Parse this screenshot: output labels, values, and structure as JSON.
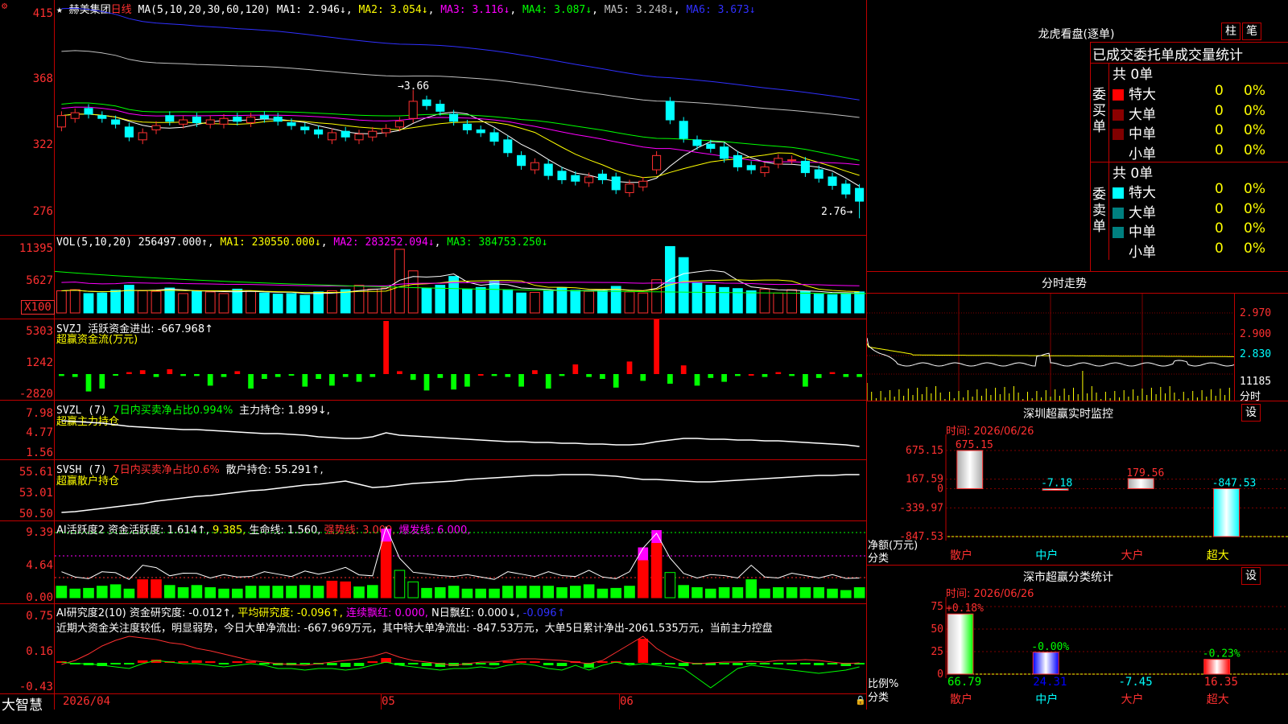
{
  "main_chart": {
    "header": {
      "star": "★",
      "name": "赫美集团",
      "period": "日线",
      "ma_def": "MA(5,10,20,30,60,120)",
      "ma1": "MA1: 2.946↓",
      "ma2": "MA2: 3.054↓",
      "ma3": "MA3: 3.116↓",
      "ma4": "MA4: 3.087↓",
      "ma5": "MA5: 3.248↓",
      "ma6": "MA6: 3.673↓"
    },
    "y_ticks": [
      "415",
      "368",
      "322",
      "276"
    ],
    "high_label": "3.66",
    "low_label": "2.76"
  },
  "vol_panel": {
    "header": {
      "def": "VOL(5,10,20)",
      "v": "256497.000↑",
      "ma1": "MA1: 230550.000↓",
      "ma2": "MA2: 283252.094↓",
      "ma3": "MA3: 384753.250↓"
    },
    "y_ticks": [
      "11395",
      "5627",
      "X100"
    ]
  },
  "svzj_panel": {
    "header": {
      "def": "SVZJ",
      "label": "活跃资金进出: -667.968↑",
      "sub": "超赢资金流(万元)"
    },
    "y_ticks": [
      "5303",
      "1242",
      "-2820"
    ]
  },
  "svzl_panel": {
    "header": {
      "def": "SVZL (7)",
      "label": "7日内买卖净占比0.994%",
      "label2": "主力持仓: 1.899↓,",
      "sub": "超赢主力持仓"
    },
    "y_ticks": [
      "7.98",
      "4.77",
      "1.56"
    ]
  },
  "svsh_panel": {
    "header": {
      "def": "SVSH (7)",
      "label": "7日内买卖净占比0.6%",
      "label2": "散户持仓: 55.291↑,",
      "sub": "超赢散户持仓"
    },
    "y_ticks": [
      "55.61",
      "53.01",
      "50.50"
    ]
  },
  "ai_active_panel": {
    "header": {
      "def": "AI活跃度2",
      "a": "资金活跃度: 1.614↑,",
      "b": "9.385,",
      "c": "生命线: 1.560,",
      "d": "强势线: 3.000,",
      "e": "爆发线: 6.000,"
    },
    "y_ticks": [
      "9.39",
      "4.64",
      "0.00"
    ]
  },
  "ai_research_panel": {
    "header": {
      "def": "AI研究度2(10)",
      "a": "资金研究度: -0.012↑,",
      "b": "平均研究度: -0.096↑,",
      "c": "连续飘红: 0.000,",
      "d": "N日飘红: 0.000↓,",
      "e": "-0.096↑"
    },
    "comment": "近期大资金关注度较低，明显弱势，今日大单净流出: -667.969万元，其中特大单净流出: -847.53万元，大单5日累计净出-2061.535万元，当前主力控盘",
    "y_ticks": [
      "0.75",
      "0.16",
      "-0.43"
    ]
  },
  "bottom_bar": {
    "brand": "大智慧",
    "dates": [
      "2026/04",
      "05",
      "06"
    ]
  },
  "right_panel": {
    "longhu": {
      "title": "龙虎看盘(逐单)",
      "btn_bar": "柱",
      "btn_tick": "笔",
      "header": "已成交委托单成交量统计",
      "buy": {
        "side_label": "委买单",
        "total": "共 0单",
        "rows": [
          {
            "name": "特大",
            "count": "0",
            "pct": "0%",
            "color": "#ff0000"
          },
          {
            "name": "大单",
            "count": "0",
            "pct": "0%",
            "color": "#8b0000"
          },
          {
            "name": "中单",
            "count": "0",
            "pct": "0%",
            "color": "#800000"
          },
          {
            "name": "小单",
            "count": "0",
            "pct": "0%",
            "color": "#000000"
          }
        ]
      },
      "sell": {
        "side_label": "委卖单",
        "total": "共 0单",
        "rows": [
          {
            "name": "特大",
            "count": "0",
            "pct": "0%",
            "color": "#00ffff"
          },
          {
            "name": "大单",
            "count": "0",
            "pct": "0%",
            "color": "#008080"
          },
          {
            "name": "中单",
            "count": "0",
            "pct": "0%",
            "color": "#008080"
          },
          {
            "name": "小单",
            "count": "0",
            "pct": "0%",
            "color": "#000000"
          }
        ]
      }
    },
    "intraday": {
      "title": "分时走势",
      "y_ticks": [
        "2.970",
        "2.900",
        "2.830",
        "11185",
        "分时"
      ]
    },
    "sz_monitor": {
      "title": "深圳超赢实时监控",
      "btn": "设",
      "time_label": "时间: 2026/06/26",
      "y_ticks": [
        "675.15",
        "167.59",
        "0",
        "-339.97",
        "-847.53"
      ],
      "y_axis_label": "净额(万元)",
      "x_axis_label": "分类",
      "categories": [
        "散户",
        "中户",
        "大户",
        "超大"
      ],
      "values": [
        675.15,
        -7.18,
        179.56,
        -847.53
      ],
      "value_labels": [
        "675.15",
        "-7.18",
        "179.56",
        "-847.53"
      ]
    },
    "sz_classify": {
      "title": "深市超赢分类统计",
      "btn": "设",
      "time_label": "时间: 2026/06/26",
      "y_ticks": [
        "75",
        "50",
        "25",
        "0"
      ],
      "y_axis_label": "比例%",
      "x_axis_label": "分类",
      "categories": [
        "散户",
        "中户",
        "大户",
        "超大"
      ],
      "pct_labels": [
        "+0.18%",
        "-0.00%",
        "",
        "-0.23%"
      ],
      "bottom_values": [
        "66.79",
        "24.31",
        "-7.45",
        "16.35"
      ],
      "values": [
        66.79,
        24.31,
        0,
        16.35
      ]
    }
  },
  "colors": {
    "up": "#ff3030",
    "down": "#00ffff",
    "border": "#c00000",
    "ma5": "#ffffff",
    "ma10": "#ffff00",
    "ma20": "#ff00ff",
    "ma30": "#00ff00",
    "ma60": "#c0c0c0",
    "ma120": "#3030ff"
  }
}
